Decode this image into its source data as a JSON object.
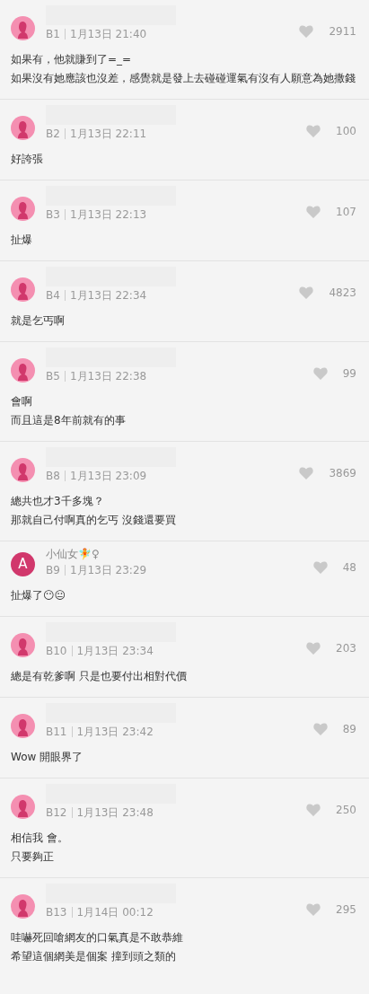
{
  "comments": [
    {
      "avatar": {
        "kind": "silhouette"
      },
      "name_redacted": true,
      "floor": "B1",
      "time": "1月13日 21:40",
      "likes": "2911",
      "lines": [
        "如果有，他就賺到了=_=",
        "如果沒有她應該也沒差，感覺就是發上去碰碰運氣有沒有人願意為她撒錢"
      ]
    },
    {
      "avatar": {
        "kind": "silhouette"
      },
      "name_redacted": true,
      "floor": "B2",
      "time": "1月13日 22:11",
      "likes": "100",
      "lines": [
        "好誇張"
      ]
    },
    {
      "avatar": {
        "kind": "silhouette"
      },
      "name_redacted": true,
      "floor": "B3",
      "time": "1月13日 22:13",
      "likes": "107",
      "lines": [
        "扯爆"
      ]
    },
    {
      "avatar": {
        "kind": "silhouette"
      },
      "name_redacted": true,
      "floor": "B4",
      "time": "1月13日 22:34",
      "likes": "4823",
      "lines": [
        "就是乞丐啊"
      ]
    },
    {
      "avatar": {
        "kind": "silhouette"
      },
      "name_redacted": true,
      "floor": "B5",
      "time": "1月13日 22:38",
      "likes": "99",
      "lines": [
        "會啊",
        "而且這是8年前就有的事"
      ]
    },
    {
      "avatar": {
        "kind": "silhouette"
      },
      "name_redacted": true,
      "floor": "B8",
      "time": "1月13日 23:09",
      "likes": "3869",
      "lines": [
        "總共也才3千多塊？",
        "那就自己付啊真的乞丐 沒錢還要買"
      ]
    },
    {
      "avatar": {
        "kind": "letter",
        "letter": "A"
      },
      "name": "小仙女🧚♀",
      "floor": "B9",
      "time": "1月13日 23:29",
      "likes": "48",
      "lines": [
        "扯爆了😶😐"
      ]
    },
    {
      "avatar": {
        "kind": "silhouette"
      },
      "name_redacted": true,
      "floor": "B10",
      "time": "1月13日 23:34",
      "likes": "203",
      "lines": [
        "總是有乾爹啊 只是也要付出相對代價"
      ]
    },
    {
      "avatar": {
        "kind": "silhouette"
      },
      "name_redacted": true,
      "floor": "B11",
      "time": "1月13日 23:42",
      "likes": "89",
      "lines": [
        "Wow 開眼界了"
      ]
    },
    {
      "avatar": {
        "kind": "silhouette"
      },
      "name_redacted": true,
      "floor": "B12",
      "time": "1月13日 23:48",
      "likes": "250",
      "lines": [
        "相信我 會。",
        "只要夠正"
      ]
    },
    {
      "avatar": {
        "kind": "silhouette"
      },
      "name_redacted": true,
      "floor": "B13",
      "time": "1月14日 00:12",
      "likes": "295",
      "lines": [
        "哇嚇死回嗆網友的口氣真是不敢恭維",
        "希望這個網美是個案 撞到頭之類的"
      ]
    }
  ]
}
